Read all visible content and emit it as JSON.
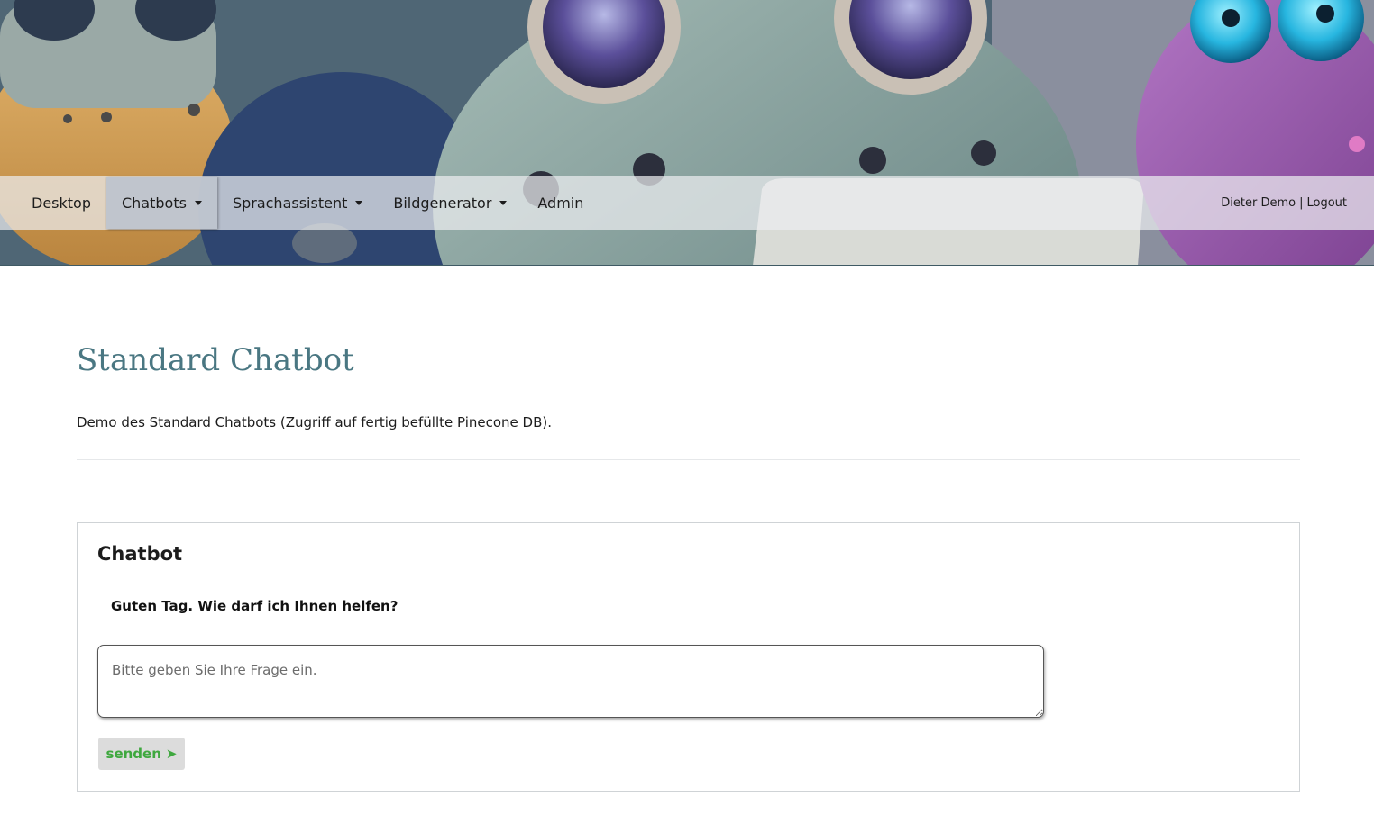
{
  "nav": {
    "items": [
      {
        "label": "Desktop",
        "dropdown": false,
        "active": false
      },
      {
        "label": "Chatbots",
        "dropdown": true,
        "active": true
      },
      {
        "label": "Sprachassistent",
        "dropdown": true,
        "active": false
      },
      {
        "label": "Bildgenerator",
        "dropdown": true,
        "active": false
      },
      {
        "label": "Admin",
        "dropdown": false,
        "active": false
      }
    ],
    "user_name": "Dieter Demo",
    "separator": "|",
    "logout_label": "Logout"
  },
  "page": {
    "title": "Standard Chatbot",
    "description": "Demo des Standard Chatbots (Zugriff auf fertig befüllte Pinecone DB)."
  },
  "chat": {
    "card_title": "Chatbot",
    "greeting": "Guten Tag. Wie darf ich Ihnen helfen?",
    "input_placeholder": "Bitte geben Sie Ihre Frage ein.",
    "input_value": "",
    "send_label": "senden",
    "send_icon": "➤"
  },
  "colors": {
    "title": "#4a7782",
    "send_text": "#3fa83f",
    "send_bg": "#dcdcdc",
    "navbar_active": "#bec4cd"
  }
}
